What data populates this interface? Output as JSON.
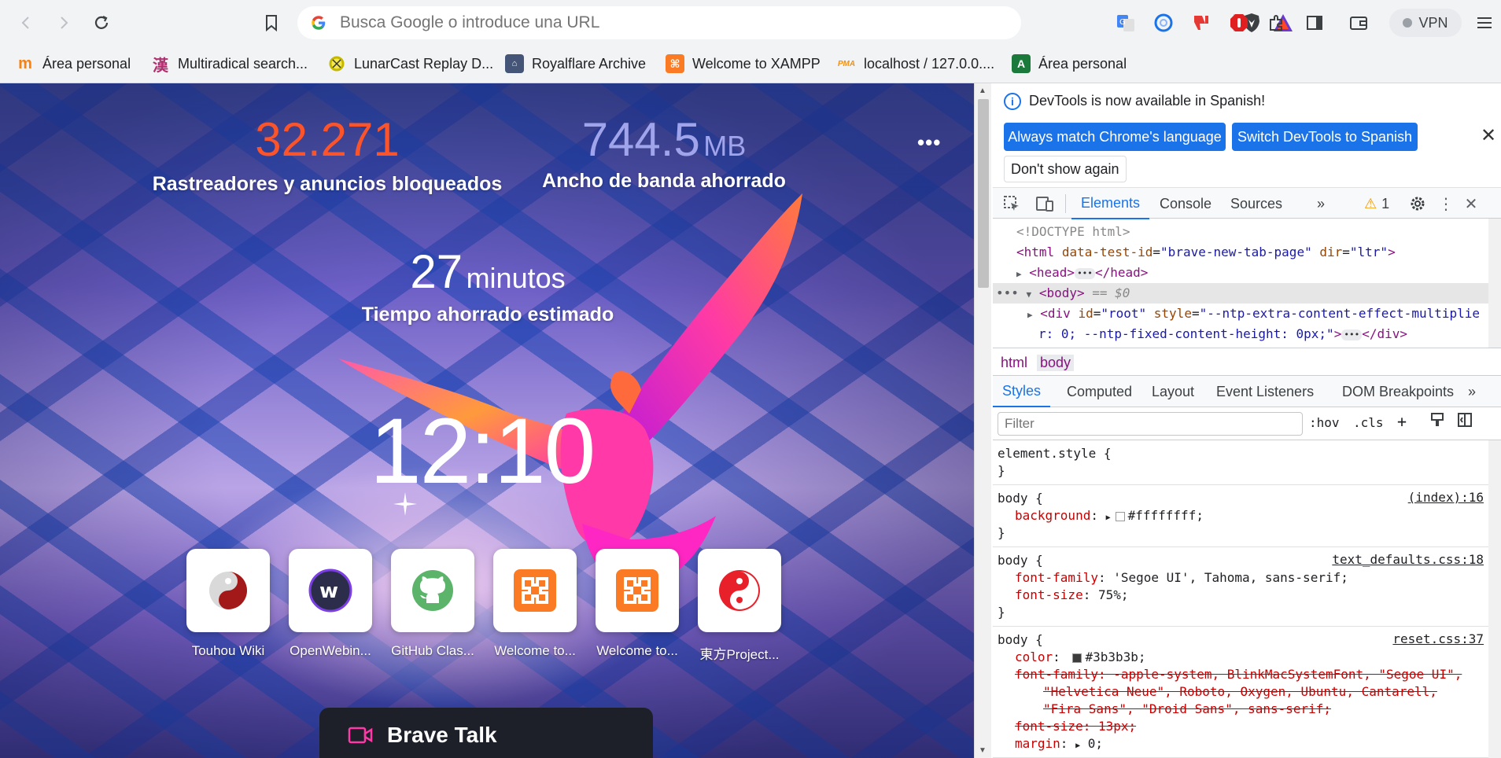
{
  "toolbar": {
    "omnibox_placeholder": "Busca Google o introduce una URL",
    "vpn_label": "VPN"
  },
  "bookmarks": [
    {
      "label": "Área personal",
      "icon": "moodle-icon",
      "color": "#f98012"
    },
    {
      "label": "Multiradical search...",
      "icon": "kanji-icon",
      "color": "#b0306f"
    },
    {
      "label": "LunarCast Replay D...",
      "icon": "yellow-ring-icon",
      "color": "#d4c300"
    },
    {
      "label": "Royalflare Archive",
      "icon": "archive-icon",
      "color": "#445577"
    },
    {
      "label": "Welcome to XAMPP",
      "icon": "xampp-icon",
      "color": "#fb7a24"
    },
    {
      "label": "localhost / 127.0.0....",
      "icon": "phpmyadmin-icon",
      "color": "#f29111"
    },
    {
      "label": "Área personal",
      "icon": "triangle-a-icon",
      "color": "#1b7a3b"
    }
  ],
  "ntp": {
    "trackers_count": "32.271",
    "trackers_label": "Rastreadores y anuncios bloqueados",
    "bandwidth_value": "744.5",
    "bandwidth_unit": "MB",
    "bandwidth_label": "Ancho de banda ahorrado",
    "time_value": "27",
    "time_unit": "minutos",
    "time_label": "Tiempo ahorrado estimado",
    "clock": "12:10",
    "tiles": [
      {
        "label": "Touhou Wiki",
        "icon": "yin-yang-icon"
      },
      {
        "label": "OpenWebin...",
        "icon": "openwebinars-icon"
      },
      {
        "label": "GitHub Clas...",
        "icon": "github-icon"
      },
      {
        "label": "Welcome to...",
        "icon": "xampp-icon"
      },
      {
        "label": "Welcome to...",
        "icon": "xampp-icon"
      },
      {
        "label": "東方Project...",
        "icon": "yin-yang-red-icon"
      }
    ],
    "brave_talk": "Brave Talk",
    "colors": {
      "trackers": "#fb542b",
      "bandwidth": "#a0a5eb"
    }
  },
  "devtools": {
    "info_text": "DevTools is now available in Spanish!",
    "btn_match": "Always match Chrome's language",
    "btn_switch": "Switch DevTools to Spanish",
    "btn_dont_show": "Don't show again",
    "tabs": [
      "Elements",
      "Console",
      "Sources"
    ],
    "warning_count": "1",
    "dom": {
      "doctype": "<!DOCTYPE html>",
      "html_tag": "<html",
      "html_attr1": "data-test-id",
      "html_val1": "\"brave-new-tab-page\"",
      "html_attr2": "dir",
      "html_val2": "\"ltr\"",
      "head_open": "<head>",
      "head_close": "</head>",
      "body_tag": "<body>",
      "body_eq": "== $0",
      "div_tag": "<div",
      "div_attr1": "id",
      "div_val1": "\"root\"",
      "div_attr2": "style",
      "div_val2a": "\"--ntp-extra-content-effect-multiplie",
      "div_val2b": "r: 0; --ntp-fixed-content-height: 0px;\"",
      "div_close": "</div>"
    },
    "crumbs": [
      "html",
      "body"
    ],
    "sub_tabs": [
      "Styles",
      "Computed",
      "Layout",
      "Event Listeners",
      "DOM Breakpoints"
    ],
    "filter_placeholder": "Filter",
    "hov": ":hov",
    "cls": ".cls",
    "rules": {
      "element_style": "element.style {",
      "close": "}",
      "r1_sel": "body {",
      "r1_src": "(index):16",
      "r1_prop": "background",
      "r1_val": "#ffffffff;",
      "r1_swatch": "#ffffff",
      "r2_sel": "body {",
      "r2_src": "text_defaults.css:18",
      "r2_p1": "font-family",
      "r2_v1": "'Segoe UI', Tahoma, sans-serif;",
      "r2_p2": "font-size",
      "r2_v2": "75%;",
      "r3_sel": "body {",
      "r3_src": "reset.css:37",
      "r3_p1": "color",
      "r3_v1": "#3b3b3b;",
      "r3_swatch": "#3b3b3b",
      "r3_ff_1": "font-family: -apple-system, BlinkMacSystemFont, \"Segoe UI\",",
      "r3_ff_2": "\"Helvetica Neue\", Roboto, Oxygen, Ubuntu, Cantarell,",
      "r3_ff_3": "\"Fira Sans\", \"Droid Sans\", sans-serif;",
      "r3_fs": "font-size: 13px;",
      "r3_p4": "margin",
      "r3_v4": "0;"
    }
  }
}
